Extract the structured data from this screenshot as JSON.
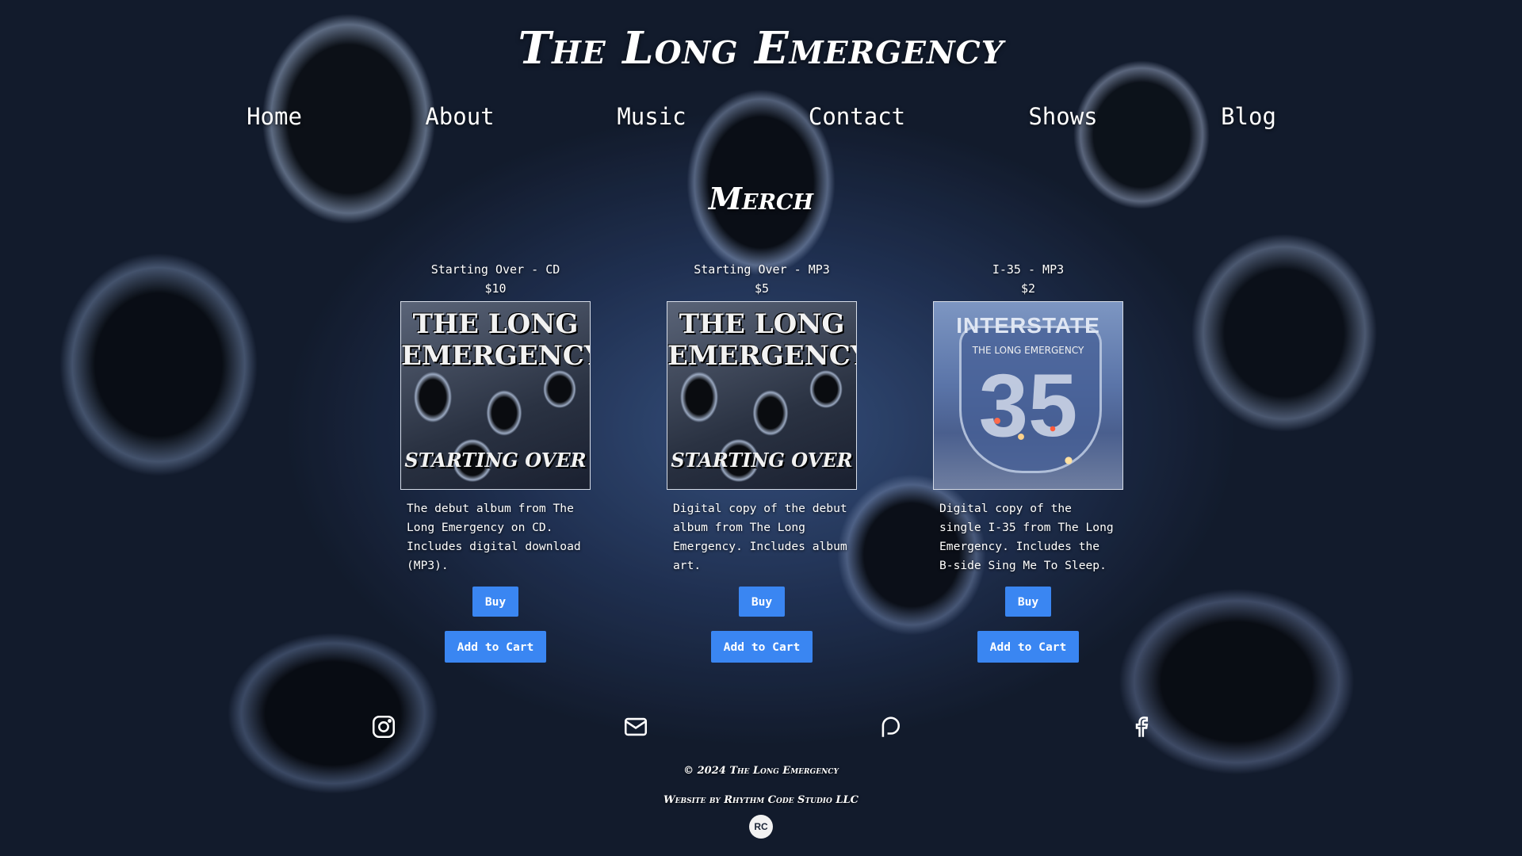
{
  "site": {
    "title": "The Long Emergency"
  },
  "nav": {
    "items": [
      "Home",
      "About",
      "Music",
      "Contact",
      "Shows",
      "Blog"
    ]
  },
  "merch": {
    "heading": "Merch",
    "products": [
      {
        "name": "Starting Over - CD",
        "price": "$10",
        "cover_top": "THE LONG EMERGENCY",
        "cover_bottom": "STARTING OVER",
        "description": "The debut album from The Long Emergency on CD. Includes digital download (MP3).",
        "buy_label": "Buy",
        "cart_label": "Add to Cart"
      },
      {
        "name": "Starting Over - MP3",
        "price": "$5",
        "cover_top": "THE LONG EMERGENCY",
        "cover_bottom": "STARTING OVER",
        "description": "Digital copy of the debut album from The Long Emergency. Includes album art.",
        "buy_label": "Buy",
        "cart_label": "Add to Cart"
      },
      {
        "name": "I-35 - MP3",
        "price": "$2",
        "cover_top": "INTERSTATE",
        "cover_band": "THE LONG EMERGENCY",
        "cover_number": "35",
        "description": "Digital copy of the single I-35 from The Long Emergency. Includes the B-side Sing Me To Sleep.",
        "buy_label": "Buy",
        "cart_label": "Add to Cart"
      }
    ]
  },
  "social": {
    "icons": [
      "instagram-icon",
      "mail-icon",
      "patreon-icon",
      "facebook-icon"
    ]
  },
  "footer": {
    "copyright": "© 2024 The Long Emergency",
    "credit": "Website by Rhythm Code Studio LLC",
    "logo_text": "RC"
  },
  "colors": {
    "button": "#3a86f2",
    "text": "#ffffff"
  }
}
